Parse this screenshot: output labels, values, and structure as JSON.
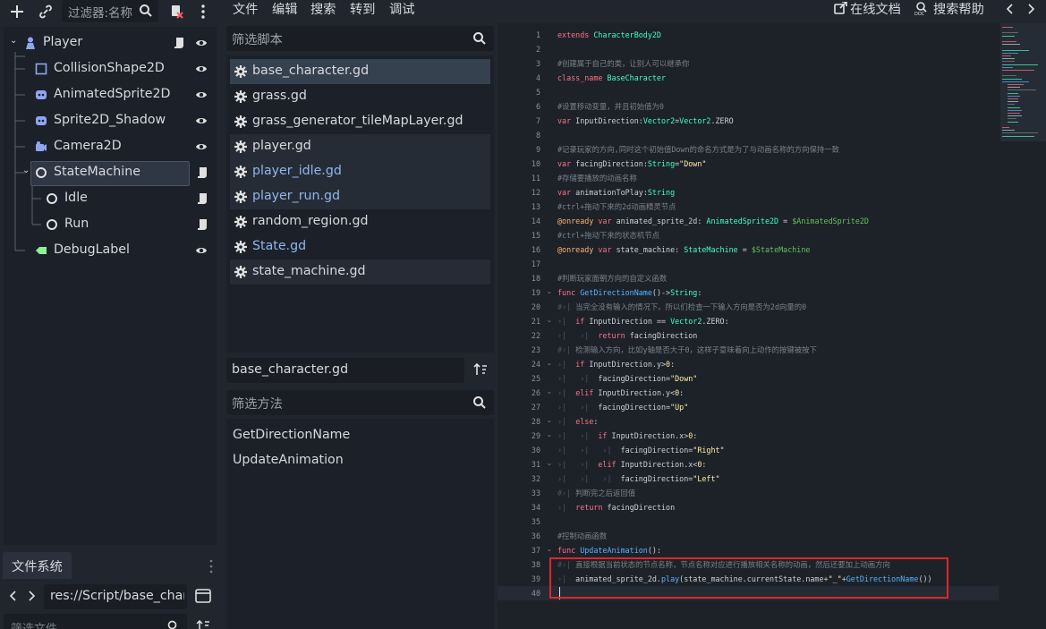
{
  "scene_dock": {
    "filter_placeholder": "过滤器:名称",
    "nodes": [
      {
        "name": "Player",
        "icon": "player-node-icon",
        "color": "#8da5f3",
        "depth": 0,
        "has_script": true,
        "visible_icon": true
      },
      {
        "name": "CollisionShape2D",
        "icon": "collision-shape-icon",
        "color": "#8da5f3",
        "depth": 1,
        "has_script": false,
        "visible_icon": true
      },
      {
        "name": "AnimatedSprite2D",
        "icon": "animated-sprite-icon",
        "color": "#8da5f3",
        "depth": 1,
        "has_script": false,
        "visible_icon": true
      },
      {
        "name": "Sprite2D_Shadow",
        "icon": "sprite-icon",
        "color": "#8da5f3",
        "depth": 1,
        "has_script": false,
        "visible_icon": true
      },
      {
        "name": "Camera2D",
        "icon": "camera-icon",
        "color": "#8da5f3",
        "depth": 1,
        "has_script": false,
        "visible_icon": true
      },
      {
        "name": "StateMachine",
        "icon": "node-circle-icon",
        "color": "#e0e0e0",
        "depth": 1,
        "has_script": true,
        "visible_icon": false,
        "selected": true
      },
      {
        "name": "Idle",
        "icon": "node-circle-icon",
        "color": "#e0e0e0",
        "depth": 2,
        "has_script": true,
        "visible_icon": false
      },
      {
        "name": "Run",
        "icon": "node-circle-icon",
        "color": "#e0e0e0",
        "depth": 2,
        "has_script": true,
        "visible_icon": false
      },
      {
        "name": "DebugLabel",
        "icon": "label-icon",
        "color": "#8eef97",
        "depth": 1,
        "has_script": false,
        "visible_icon": true
      }
    ]
  },
  "filesystem": {
    "tab_label": "文件系统",
    "path": "res://Script/base_char",
    "filter_placeholder": "筛选文件"
  },
  "menu": {
    "items": [
      "文件",
      "编辑",
      "搜索",
      "转到",
      "调试"
    ],
    "online_docs": "在线文档",
    "search_help": "搜索帮助"
  },
  "script_panel": {
    "filter_placeholder": "筛选脚本",
    "scripts": [
      {
        "name": "base_character.gd",
        "state": "active"
      },
      {
        "name": "grass.gd",
        "state": "normal"
      },
      {
        "name": "grass_generator_tileMapLayer.gd",
        "state": "normal"
      },
      {
        "name": "player.gd",
        "state": "open"
      },
      {
        "name": "player_idle.gd",
        "state": "open-blue"
      },
      {
        "name": "player_run.gd",
        "state": "open-blue"
      },
      {
        "name": "random_region.gd",
        "state": "normal"
      },
      {
        "name": "State.gd",
        "state": "normal-blue"
      },
      {
        "name": "state_machine.gd",
        "state": "open"
      }
    ],
    "current_script": "base_character.gd",
    "method_filter_placeholder": "筛选方法",
    "methods": [
      "GetDirectionName",
      "UpdateAnimation"
    ]
  },
  "code": {
    "lines": [
      "<span class=\"kw\">extends</span> <span class=\"ty\">CharacterBody2D</span>",
      "",
      "<span class=\"cm\">#创建属于自己的类，让别人可以继承你</span>",
      "<span class=\"kw\">class_name</span> <span class=\"ty\">BaseCharacter</span>",
      "",
      "<span class=\"cm\">#设置移动变量，并且初始值为0</span>",
      "<span class=\"kw\">var</span> InputDirection:<span class=\"ty\">Vector2</span>=<span class=\"ty\">Vector2</span>.ZERO",
      "",
      "<span class=\"cm\">#记录玩家的方向,同时这个初始值Down的命名方式是为了与动画名称的方向保持一致</span>",
      "<span class=\"kw\">var</span> facingDirection:<span class=\"ty\">String</span>=<span class=\"st\">\"Down\"</span>",
      "<span class=\"cm\">#存储要播放的动画名称</span>",
      "<span class=\"kw\">var</span> animationToPlay:<span class=\"ty\">String</span>",
      "<span class=\"cm\">#ctrl+拖动下来的2d动画精灵节点</span>",
      "<span class=\"an\">@onready</span> <span class=\"kw\">var</span> animated_sprite_2d: <span class=\"ty\">AnimatedSprite2D</span> = <span class=\"nd\">$AnimatedSprite2D</span>",
      "<span class=\"cm\">#ctrl+拖动下来的状态机节点</span>",
      "<span class=\"an\">@onready</span> <span class=\"kw\">var</span> state_machine: <span class=\"ty\">StateMachine</span> = <span class=\"nd\">$StateMachine</span>",
      "",
      "<span class=\"cm\">#判断玩家面朝方向的自定义函数</span>",
      "<span class=\"kw\">func</span> <span class=\"fn\">GetDirectionName</span>()-><span class=\"ty\">String</span>:",
      "<span class=\"tab\">#›|</span><span class=\"cm\"> 当完全没有输入的情况下。所以们检查一下输入方向是否为2d向量的0</span>",
      "<span class=\"tab\">›|</span>  <span class=\"kw\">if</span> InputDirection == <span class=\"ty\">Vector2</span>.ZERO:",
      "<span class=\"tab\">›|   ›|</span>  <span class=\"kw\">return</span> facingDirection",
      "<span class=\"tab\">#›|</span><span class=\"cm\"> 检测输入方向，比如y轴是否大于0，这样子意味着向上动作的按键被按下</span>",
      "<span class=\"tab\">›|</span>  <span class=\"kw\">if</span> InputDirection.y><span class=\"st\">0</span>:",
      "<span class=\"tab\">›|   ›|</span>  facingDirection=<span class=\"st\">\"Down\"</span>",
      "<span class=\"tab\">›|</span>  <span class=\"kw\">elif</span> InputDirection.y<<span class=\"st\">0</span>:",
      "<span class=\"tab\">›|   ›|</span>  facingDirection=<span class=\"st\">\"Up\"</span>",
      "<span class=\"tab\">›|</span>  <span class=\"kw\">else</span>:",
      "<span class=\"tab\">›|   ›|</span>  <span class=\"kw\">if</span> InputDirection.x><span class=\"st\">0</span>:",
      "<span class=\"tab\">›|   ›|   ›|</span>  facingDirection=<span class=\"st\">\"Right\"</span>",
      "<span class=\"tab\">›|   ›|</span>  <span class=\"kw\">elif</span> InputDirection.x<<span class=\"st\">0</span>:",
      "<span class=\"tab\">›|   ›|   ›|</span>  facingDirection=<span class=\"st\">\"Left\"</span>",
      "<span class=\"tab\">#›|</span><span class=\"cm\"> 判断完之后返回值</span>",
      "<span class=\"tab\">›|</span>  <span class=\"kw\">return</span> facingDirection",
      "",
      "<span class=\"cm\">#控制动画函数</span>",
      "<span class=\"kw\">func</span> <span class=\"fn\">UpdateAnimation</span>():",
      "<span class=\"tab\">#›|</span><span class=\"cm\"> 直接根据当前状态的节点名称，节点名称对应进行播放相关名称的动画，然后还要加上动画方向</span>",
      "<span class=\"tab\">›|</span>  animated_sprite_2d.<span class=\"fn\">play</span>(state_machine.currentState.name+<span class=\"st\">\"_\"</span>+<span class=\"fn\">GetDirectionName</span>())",
      ""
    ],
    "folds": {
      "19": "v",
      "21": "v",
      "24": "v",
      "26": "v",
      "28": "v",
      "29": "v",
      "31": "v",
      "37": "v"
    }
  }
}
